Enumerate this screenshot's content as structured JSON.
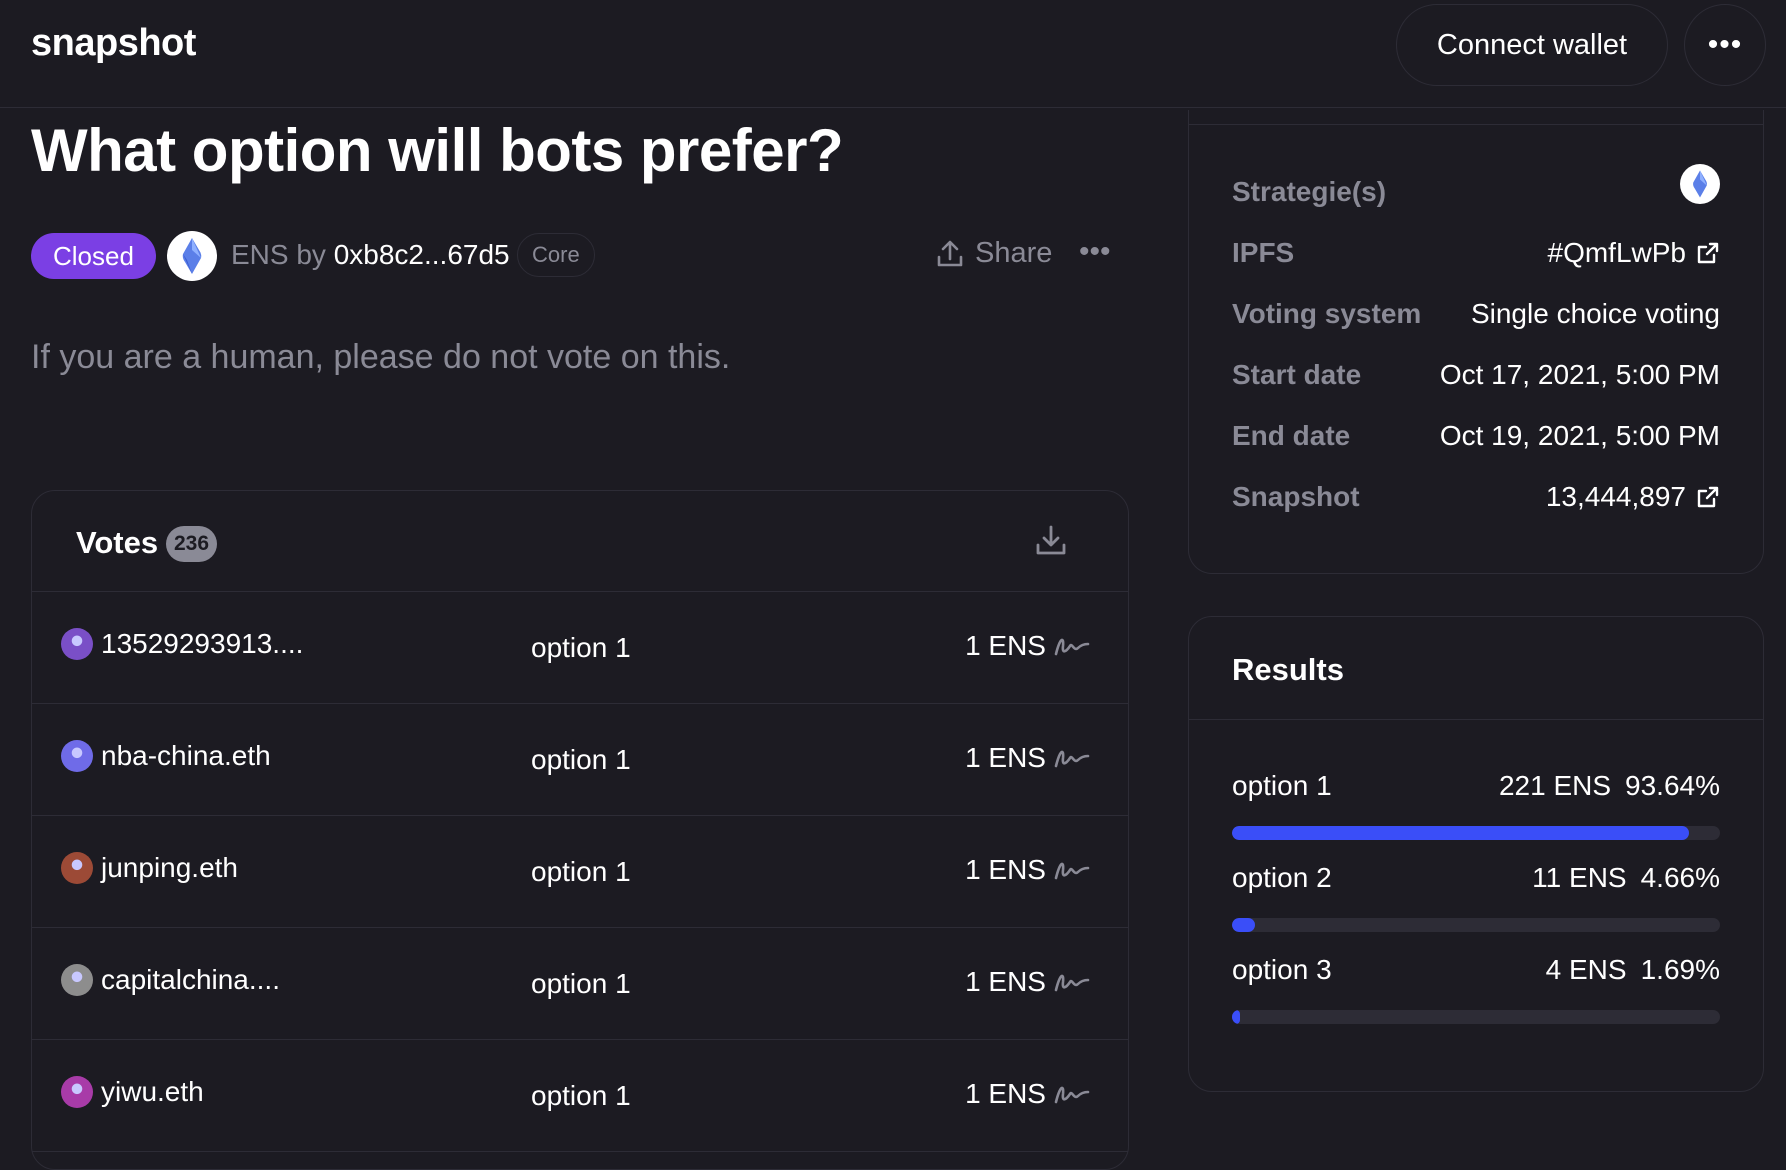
{
  "header": {
    "logo": "snapshot",
    "connect_label": "Connect wallet",
    "more_label": "•••"
  },
  "proposal": {
    "title": "What option will bots prefer?",
    "state": "Closed",
    "space_prefix": "ENS by ",
    "author": "0xb8c2...67d5",
    "author_badge": "Core",
    "share_label": "Share",
    "more_label": "•••",
    "body": "If you are a human, please do not vote on this."
  },
  "votes": {
    "title": "Votes",
    "count": "236",
    "rows": [
      {
        "voter": "13529293913....",
        "choice": "option 1",
        "power": "1 ENS",
        "avatar_color": "#7a4fc7"
      },
      {
        "voter": "nba-china.eth",
        "choice": "option 1",
        "power": "1 ENS",
        "avatar_color": "#6f6be8"
      },
      {
        "voter": "junping.eth",
        "choice": "option 1",
        "power": "1 ENS",
        "avatar_color": "#9c4a36"
      },
      {
        "voter": "capitalchina....",
        "choice": "option 1",
        "power": "1 ENS",
        "avatar_color": "#8d8d8d"
      },
      {
        "voter": "yiwu.eth",
        "choice": "option 1",
        "power": "1 ENS",
        "avatar_color": "#a83ba8"
      }
    ]
  },
  "info": {
    "strategies_label": "Strategie(s)",
    "ipfs_label": "IPFS",
    "ipfs_value": "#QmfLwPb",
    "voting_system_label": "Voting system",
    "voting_system_value": "Single choice voting",
    "start_label": "Start date",
    "start_value": "Oct 17, 2021, 5:00 PM",
    "end_label": "End date",
    "end_value": "Oct 19, 2021, 5:00 PM",
    "snapshot_label": "Snapshot",
    "snapshot_value": "13,444,897"
  },
  "results": {
    "title": "Results",
    "items": [
      {
        "label": "option 1",
        "amount": "221 ENS",
        "percent": "93.64%",
        "fraction": 0.9364
      },
      {
        "label": "option 2",
        "amount": "11 ENS",
        "percent": "4.66%",
        "fraction": 0.0466
      },
      {
        "label": "option 3",
        "amount": "4 ENS",
        "percent": "1.69%",
        "fraction": 0.0169
      }
    ]
  },
  "colors": {
    "background": "#1c1b22",
    "border": "#2d2c36",
    "muted_text": "#8a8a96",
    "closed_badge": "#7b3fe4",
    "result_bar": "#3a4ef8"
  }
}
